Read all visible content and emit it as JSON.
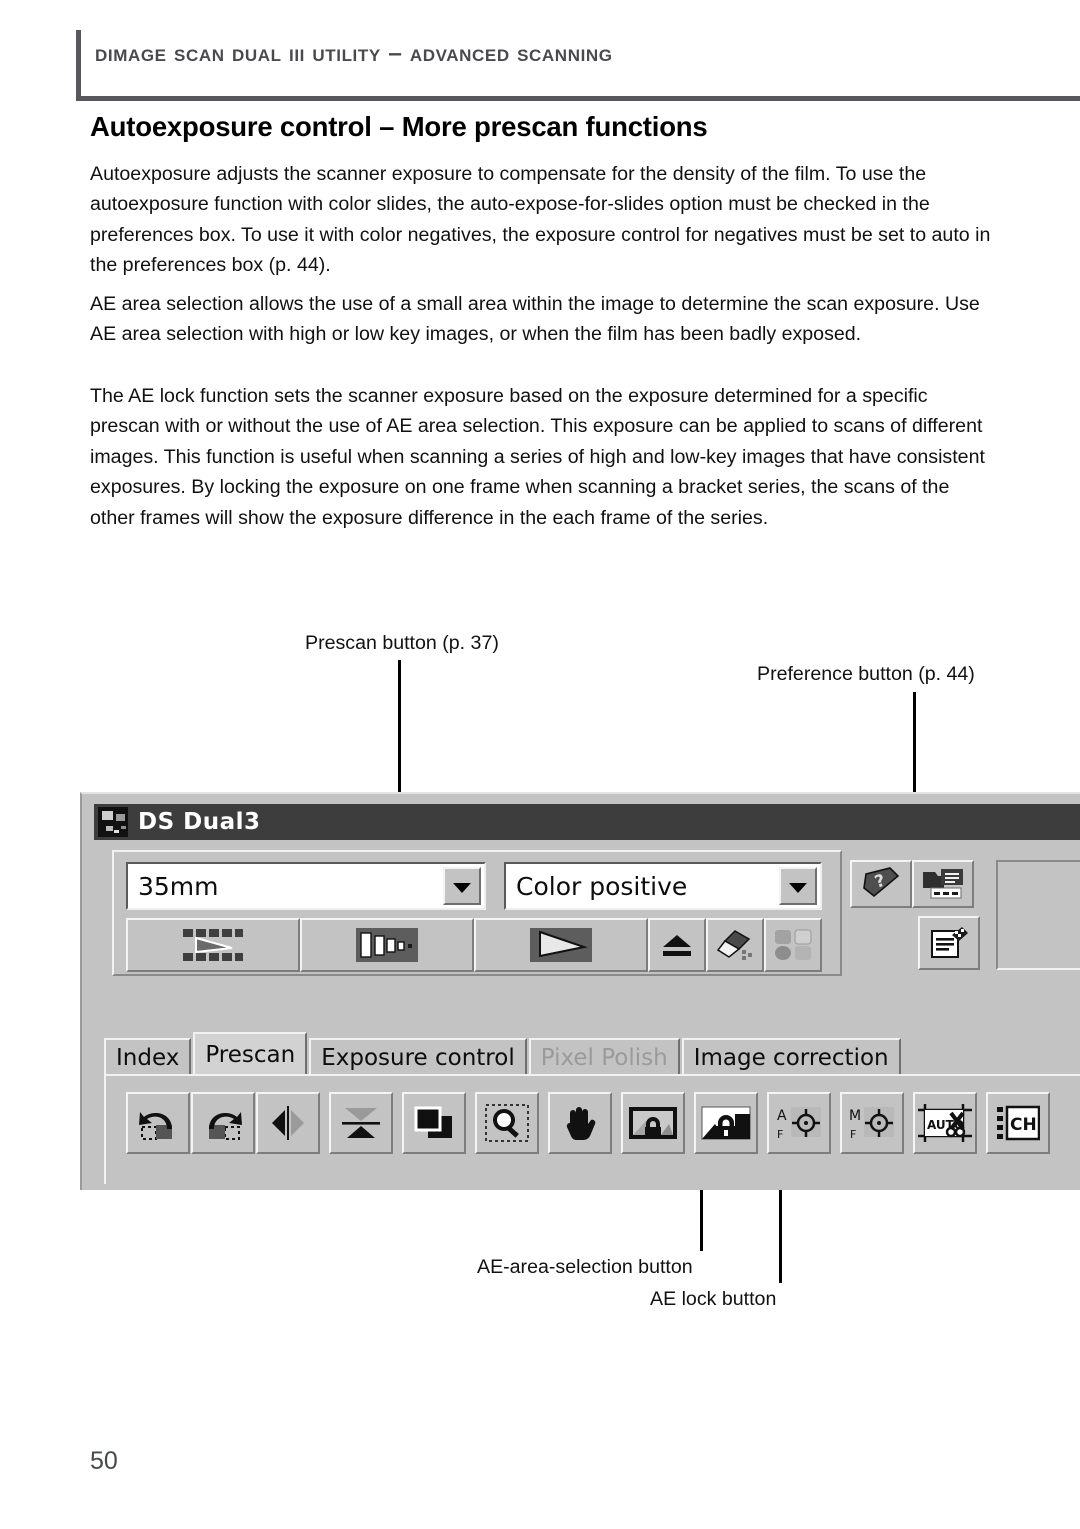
{
  "running_head": "Dimage Scan Dual III Utility – Advanced Scanning",
  "title": "Autoexposure control – More prescan functions",
  "paragraphs": {
    "p1": "Autoexposure adjusts the scanner exposure to compensate for the density of the film. To use the autoexposure function with color slides, the auto-expose-for-slides option must be checked in the preferences box. To use it with color negatives, the exposure control for negatives must be set to auto in the preferences box (p. 44).",
    "p2": "AE area selection allows the use of a small area within the image to determine the scan exposure. Use AE area selection with high or low key images, or when the film has been badly exposed.",
    "p3": "The AE lock function sets the scanner exposure based on the exposure determined for a specific prescan with or without the use of AE area selection. This exposure can be applied to scans of different images. This function is useful when scanning a series of high and low-key images that have consistent exposures. By locking the exposure on one frame when scanning a bracket series, the scans of the other frames will show the exposure difference in the each frame of the series."
  },
  "callouts": {
    "prescan": "Prescan button (p. 37)",
    "preference": "Preference button (p. 44)",
    "ae_area_selection": "AE-area-selection button",
    "ae_lock": "AE lock button"
  },
  "app": {
    "title": "DS Dual3",
    "combos": {
      "film_type": {
        "value": "35mm"
      },
      "color_mode": {
        "value": "Color positive"
      }
    },
    "scan_buttons": [
      {
        "name": "index-scan-button",
        "icon": "index-scan-icon"
      },
      {
        "name": "prescan-button",
        "icon": "prescan-icon"
      },
      {
        "name": "scan-button",
        "icon": "scan-icon"
      },
      {
        "name": "eject-button",
        "icon": "eject-icon"
      },
      {
        "name": "clean-button",
        "icon": "brush-icon"
      },
      {
        "name": "palette-button",
        "icon": "color-grid-icon"
      }
    ],
    "aux_buttons": [
      {
        "name": "help-button",
        "icon": "help-book-icon"
      },
      {
        "name": "export-button",
        "icon": "export-icon"
      },
      {
        "name": "preferences-button",
        "icon": "preferences-icon"
      }
    ],
    "tabs": [
      {
        "label": "Index",
        "state": "normal"
      },
      {
        "label": "Prescan",
        "state": "active"
      },
      {
        "label": "Exposure control",
        "state": "normal"
      },
      {
        "label": "Pixel Polish",
        "state": "disabled"
      },
      {
        "label": "Image correction",
        "state": "normal"
      }
    ],
    "edit_tools": [
      {
        "name": "rotate-left-button",
        "icon": "rotate-left-icon"
      },
      {
        "name": "rotate-right-button",
        "icon": "rotate-right-icon"
      },
      {
        "name": "flip-horizontal-button",
        "icon": "flip-horizontal-icon"
      },
      {
        "name": "flip-vertical-button",
        "icon": "flip-vertical-icon"
      },
      {
        "name": "select-all-button",
        "icon": "frames-icon"
      },
      {
        "name": "zoom-button",
        "icon": "magnifier-icon"
      },
      {
        "name": "grab-button",
        "icon": "hand-icon"
      },
      {
        "name": "ae-area-selection-button",
        "icon": "ae-area-lock-icon"
      },
      {
        "name": "ae-lock-button",
        "icon": "ae-lock-icon"
      },
      {
        "name": "auto-focus-button",
        "icon": "focus-auto-icon",
        "label": "A"
      },
      {
        "name": "manual-focus-button",
        "icon": "focus-manual-icon",
        "label": "M"
      },
      {
        "name": "auto-crop-button",
        "icon": "auto-crop-icon",
        "label": "AUTO"
      },
      {
        "name": "channel-button",
        "icon": "channel-icon",
        "label": "CH"
      }
    ]
  },
  "page_number": "50"
}
